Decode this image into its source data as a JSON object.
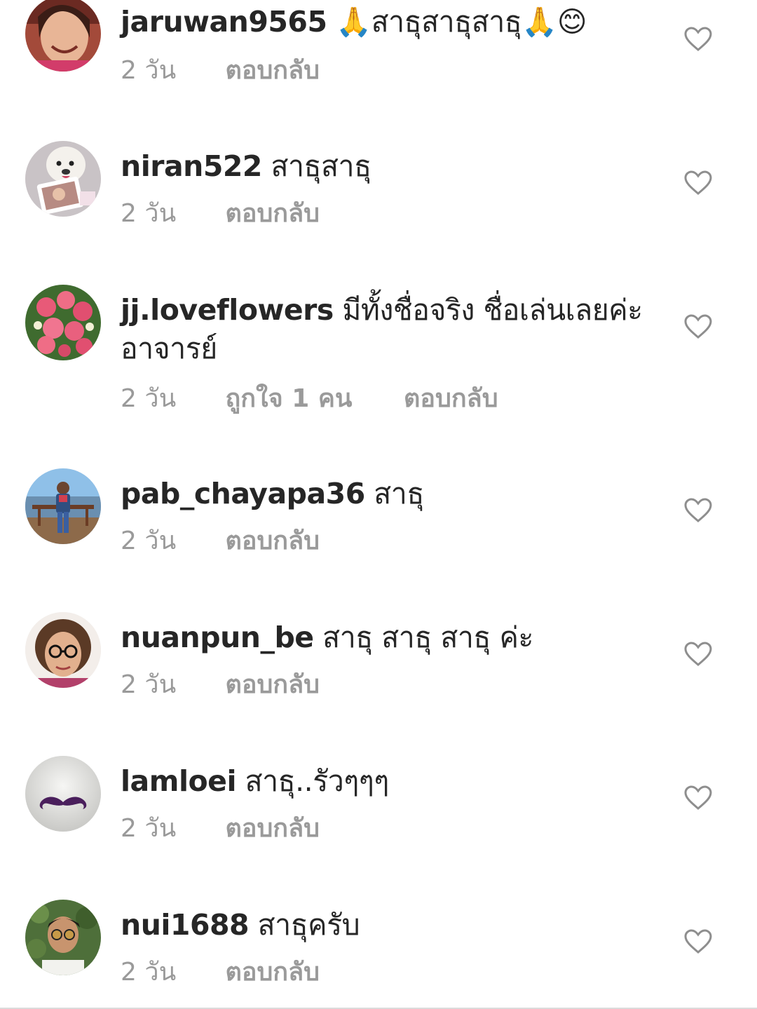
{
  "icons": {
    "like": "heart-outline-icon"
  },
  "colors": {
    "text": "#262626",
    "meta": "#9a9a9a"
  },
  "comments": [
    {
      "username": "jaruwan9565",
      "text": "🙏สาธุสาธุสาธุ🙏😊",
      "time": "2 วัน",
      "likes": "",
      "reply": "ตอบกลับ"
    },
    {
      "username": "niran522",
      "text": "สาธุสาธุ",
      "time": "2 วัน",
      "likes": "",
      "reply": "ตอบกลับ"
    },
    {
      "username": "jj.loveflowers",
      "text": "มีทั้งชื่อจริง ชื่อเล่นเลยค่ะอาจารย์",
      "time": "2 วัน",
      "likes": "ถูกใจ 1 คน",
      "reply": "ตอบกลับ"
    },
    {
      "username": "pab_chayapa36",
      "text": "สาธุ",
      "time": "2 วัน",
      "likes": "",
      "reply": "ตอบกลับ"
    },
    {
      "username": "nuanpun_be",
      "text": "สาธุ สาธุ สาธุ ค่ะ",
      "time": "2 วัน",
      "likes": "",
      "reply": "ตอบกลับ"
    },
    {
      "username": "lamloei",
      "text": "สาธุ..รัวๆๆๆ",
      "time": "2 วัน",
      "likes": "",
      "reply": "ตอบกลับ"
    },
    {
      "username": "nui1688",
      "text": "สาธุครับ",
      "time": "2 วัน",
      "likes": "",
      "reply": "ตอบกลับ"
    }
  ]
}
